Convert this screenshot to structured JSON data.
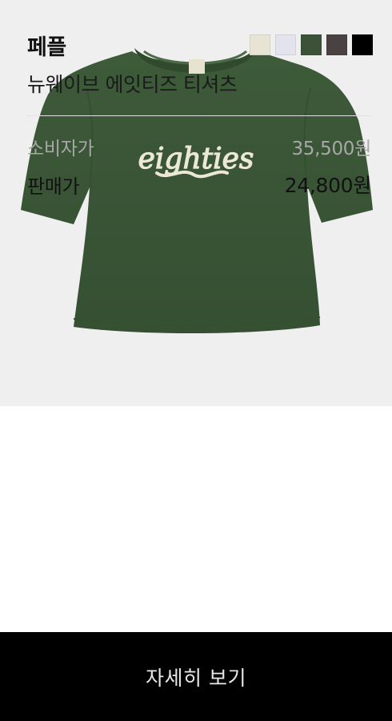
{
  "product": {
    "brand": "페플",
    "name": "뉴웨이브 에잇티즈 티셔츠",
    "image": {
      "description_icon": "tshirt-image",
      "print_text": "eighties",
      "shirt_color": "#3d5a39",
      "background": "#efefef"
    },
    "color_swatches": [
      {
        "color": "#e7e4d4"
      },
      {
        "color": "#e3e3ee"
      },
      {
        "color": "#3c5238"
      },
      {
        "color": "#4a4242"
      },
      {
        "color": "#000000"
      }
    ]
  },
  "pricing": {
    "retail_label": "소비자가",
    "retail_value": "35,500원",
    "sale_label": "판매가",
    "sale_value": "24,800원"
  },
  "cta": {
    "label": "자세히 보기"
  }
}
